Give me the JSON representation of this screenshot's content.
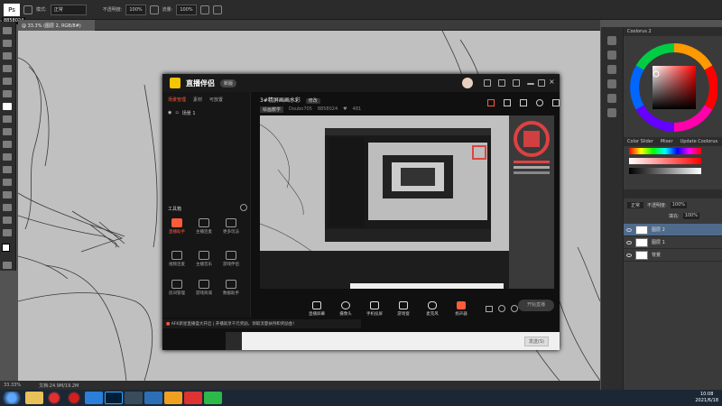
{
  "photoshop": {
    "tooltip": "8858024",
    "options": {
      "mode_label": "模式:",
      "mode_value": "正常",
      "opacity_label": "不透明度:",
      "opacity_value": "100%",
      "flow_label": "流量:",
      "flow_value": "100%"
    },
    "doc_tab": "@ 33.3% (图层 2, RGB/8#)",
    "status_zoom": "33.33%",
    "status_doc": "文档:24.9M/19.2M",
    "color_tab": "Color Slider",
    "mixer_tab": "Mixer",
    "update_tab": "Update Coolorus",
    "coolorus_title": "Coolorus 2",
    "layers_mode": "正常",
    "layers_opacity_label": "不透明度:",
    "layers_opacity": "100%",
    "layers_fill_label": "填充:",
    "layers_fill": "100%",
    "layers": [
      {
        "name": "图层 2",
        "selected": true
      },
      {
        "name": "图层 1",
        "selected": false
      },
      {
        "name": "背景",
        "selected": false
      }
    ]
  },
  "streaming_app": {
    "name": "直播伴侣",
    "version_badge": "新版",
    "left_tabs": [
      "场景管理",
      "素材",
      "可放置"
    ],
    "scene_label": "场景 1",
    "toolbox_label": "工具箱",
    "tools": [
      {
        "label": "直播助手",
        "active": true
      },
      {
        "label": "主播连麦",
        "active": false
      },
      {
        "label": "更多玩法",
        "active": false
      },
      {
        "label": "视频连麦",
        "active": false
      },
      {
        "label": "主播音乐",
        "active": false
      },
      {
        "label": "游戏伴侣",
        "active": false
      },
      {
        "label": "房间管理",
        "active": false
      },
      {
        "label": "游戏商城",
        "active": false
      },
      {
        "label": "数据助手",
        "active": false
      }
    ],
    "stream_title": "3#精屏画画水彩",
    "stream_tag": "修改",
    "meta": {
      "category": "绘画教学",
      "account": "Doubo705",
      "room_id": "8858024",
      "likes": "481"
    },
    "controls": [
      "直播屏幕",
      "摄像头",
      "手机投屏",
      "游戏窗",
      "麦克风",
      "扬声器"
    ],
    "start_button": "开始直播",
    "notice_text": "AFK新星直播盛大开启 | 开播就享千元奖励，领取流量扶持和奖励金！",
    "send_button": "发送(S)"
  },
  "taskbar": {
    "time": "10:08",
    "date": "2021/6/18"
  },
  "colors": {
    "accent": "#ff5b3a",
    "brand": "#f5c400",
    "layer_selected": "#4f6b8c"
  }
}
